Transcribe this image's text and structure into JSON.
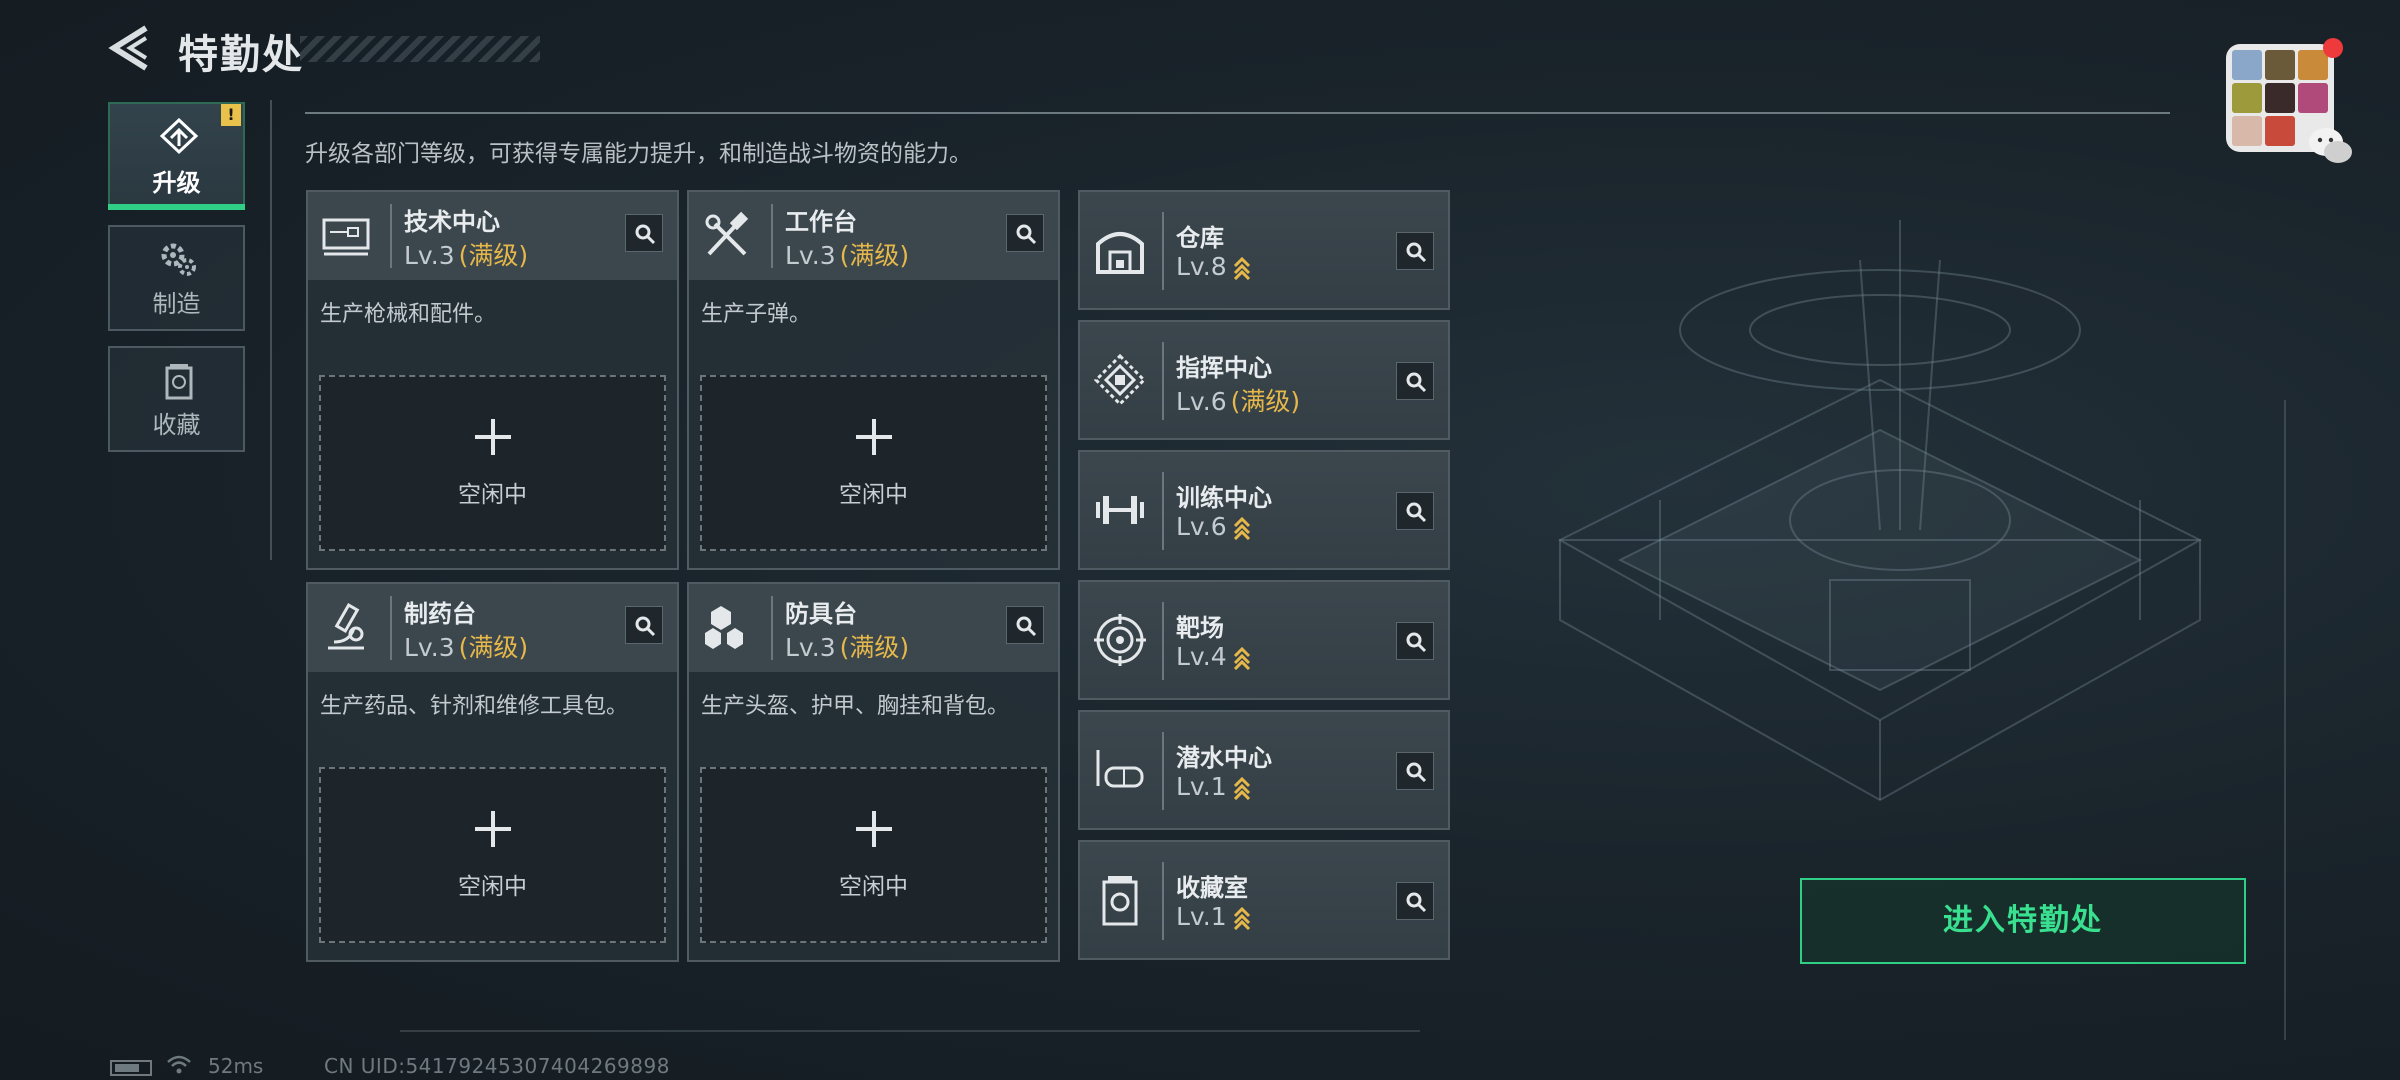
{
  "header": {
    "title": "特勤处"
  },
  "description": "升级各部门等级，可获得专属能力提升，和制造战斗物资的能力。",
  "side_tabs": [
    {
      "label": "升级",
      "icon": "upgrade-icon",
      "active": true,
      "badge": "!"
    },
    {
      "label": "制造",
      "icon": "gears-icon",
      "active": false
    },
    {
      "label": "收藏",
      "icon": "collection-icon",
      "active": false
    }
  ],
  "stations": [
    {
      "name": "技术中心",
      "level": "Lv.3",
      "max_label": "(满级)",
      "desc": "生产枪械和配件。",
      "slot_label": "空闲中",
      "icon": "tech-center-icon"
    },
    {
      "name": "工作台",
      "level": "Lv.3",
      "max_label": "(满级)",
      "desc": "生产子弹。",
      "slot_label": "空闲中",
      "icon": "workbench-icon"
    },
    {
      "name": "制药台",
      "level": "Lv.3",
      "max_label": "(满级)",
      "desc": "生产药品、针剂和维修工具包。",
      "slot_label": "空闲中",
      "icon": "pharmacy-icon"
    },
    {
      "name": "防具台",
      "level": "Lv.3",
      "max_label": "(满级)",
      "desc": "生产头盔、护甲、胸挂和背包。",
      "slot_label": "空闲中",
      "icon": "armor-bench-icon"
    }
  ],
  "facilities": [
    {
      "name": "仓库",
      "level": "Lv.8",
      "max_label": "",
      "upgradable": true,
      "icon": "warehouse-icon"
    },
    {
      "name": "指挥中心",
      "level": "Lv.6",
      "max_label": "(满级)",
      "upgradable": false,
      "icon": "command-center-icon"
    },
    {
      "name": "训练中心",
      "level": "Lv.6",
      "max_label": "",
      "upgradable": true,
      "icon": "dumbbell-icon"
    },
    {
      "name": "靶场",
      "level": "Lv.4",
      "max_label": "",
      "upgradable": true,
      "icon": "target-icon"
    },
    {
      "name": "潜水中心",
      "level": "Lv.1",
      "max_label": "",
      "upgradable": true,
      "icon": "diving-mask-icon"
    },
    {
      "name": "收藏室",
      "level": "Lv.1",
      "max_label": "",
      "upgradable": true,
      "icon": "collection-room-icon"
    }
  ],
  "enter_button": "进入特勤处",
  "footer": {
    "ping": "52ms",
    "uid": "CN UID:54179245307404269898"
  },
  "colors": {
    "accent_green": "#2fcf86",
    "max_gold": "#e6b84a",
    "badge_yellow": "#e8c24a",
    "notif_red": "#ee3a3a"
  }
}
